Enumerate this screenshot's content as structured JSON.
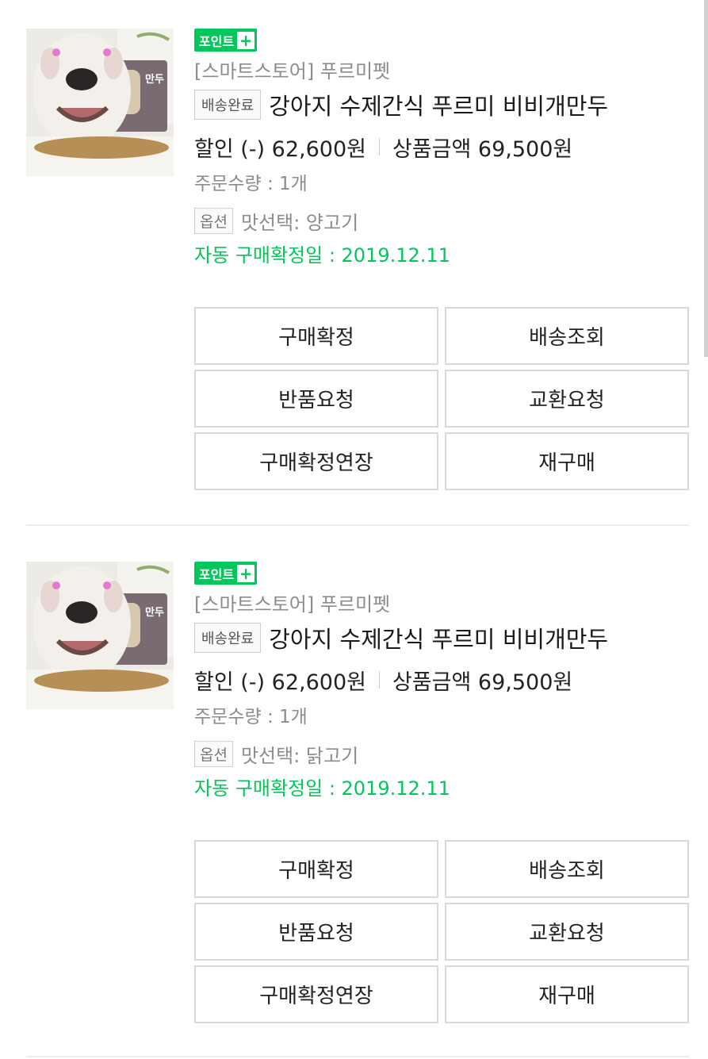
{
  "orders": [
    {
      "point_badge": "포인트",
      "point_plus": "+",
      "store": "[스마트스토어] 푸르미펫",
      "status": "배송완료",
      "product_name": "강아지 수제간식 푸르미 비비개만두",
      "discount": "할인 (-) 62,600원",
      "product_price": "상품금액 69,500원",
      "quantity": "주문수량 : 1개",
      "option_label": "옵션",
      "option_value": "맛선택: 양고기",
      "auto_confirm": "자동 구매확정일 : 2019.12.11",
      "image_brand_text": "만두",
      "buttons": {
        "confirm": "구매확정",
        "track": "배송조회",
        "return": "반품요청",
        "exchange": "교환요청",
        "extend": "구매확정연장",
        "rebuy": "재구매"
      }
    },
    {
      "point_badge": "포인트",
      "point_plus": "+",
      "store": "[스마트스토어] 푸르미펫",
      "status": "배송완료",
      "product_name": "강아지 수제간식 푸르미 비비개만두",
      "discount": "할인 (-) 62,600원",
      "product_price": "상품금액 69,500원",
      "quantity": "주문수량 : 1개",
      "option_label": "옵션",
      "option_value": "맛선택: 닭고기",
      "auto_confirm": "자동 구매확정일 : 2019.12.11",
      "image_brand_text": "만두",
      "buttons": {
        "confirm": "구매확정",
        "track": "배송조회",
        "return": "반품요청",
        "exchange": "교환요청",
        "extend": "구매확정연장",
        "rebuy": "재구매"
      }
    }
  ],
  "colors": {
    "accent_green": "#03c75a",
    "muted_text": "#8c8c8c",
    "border": "#d9d9d9"
  }
}
